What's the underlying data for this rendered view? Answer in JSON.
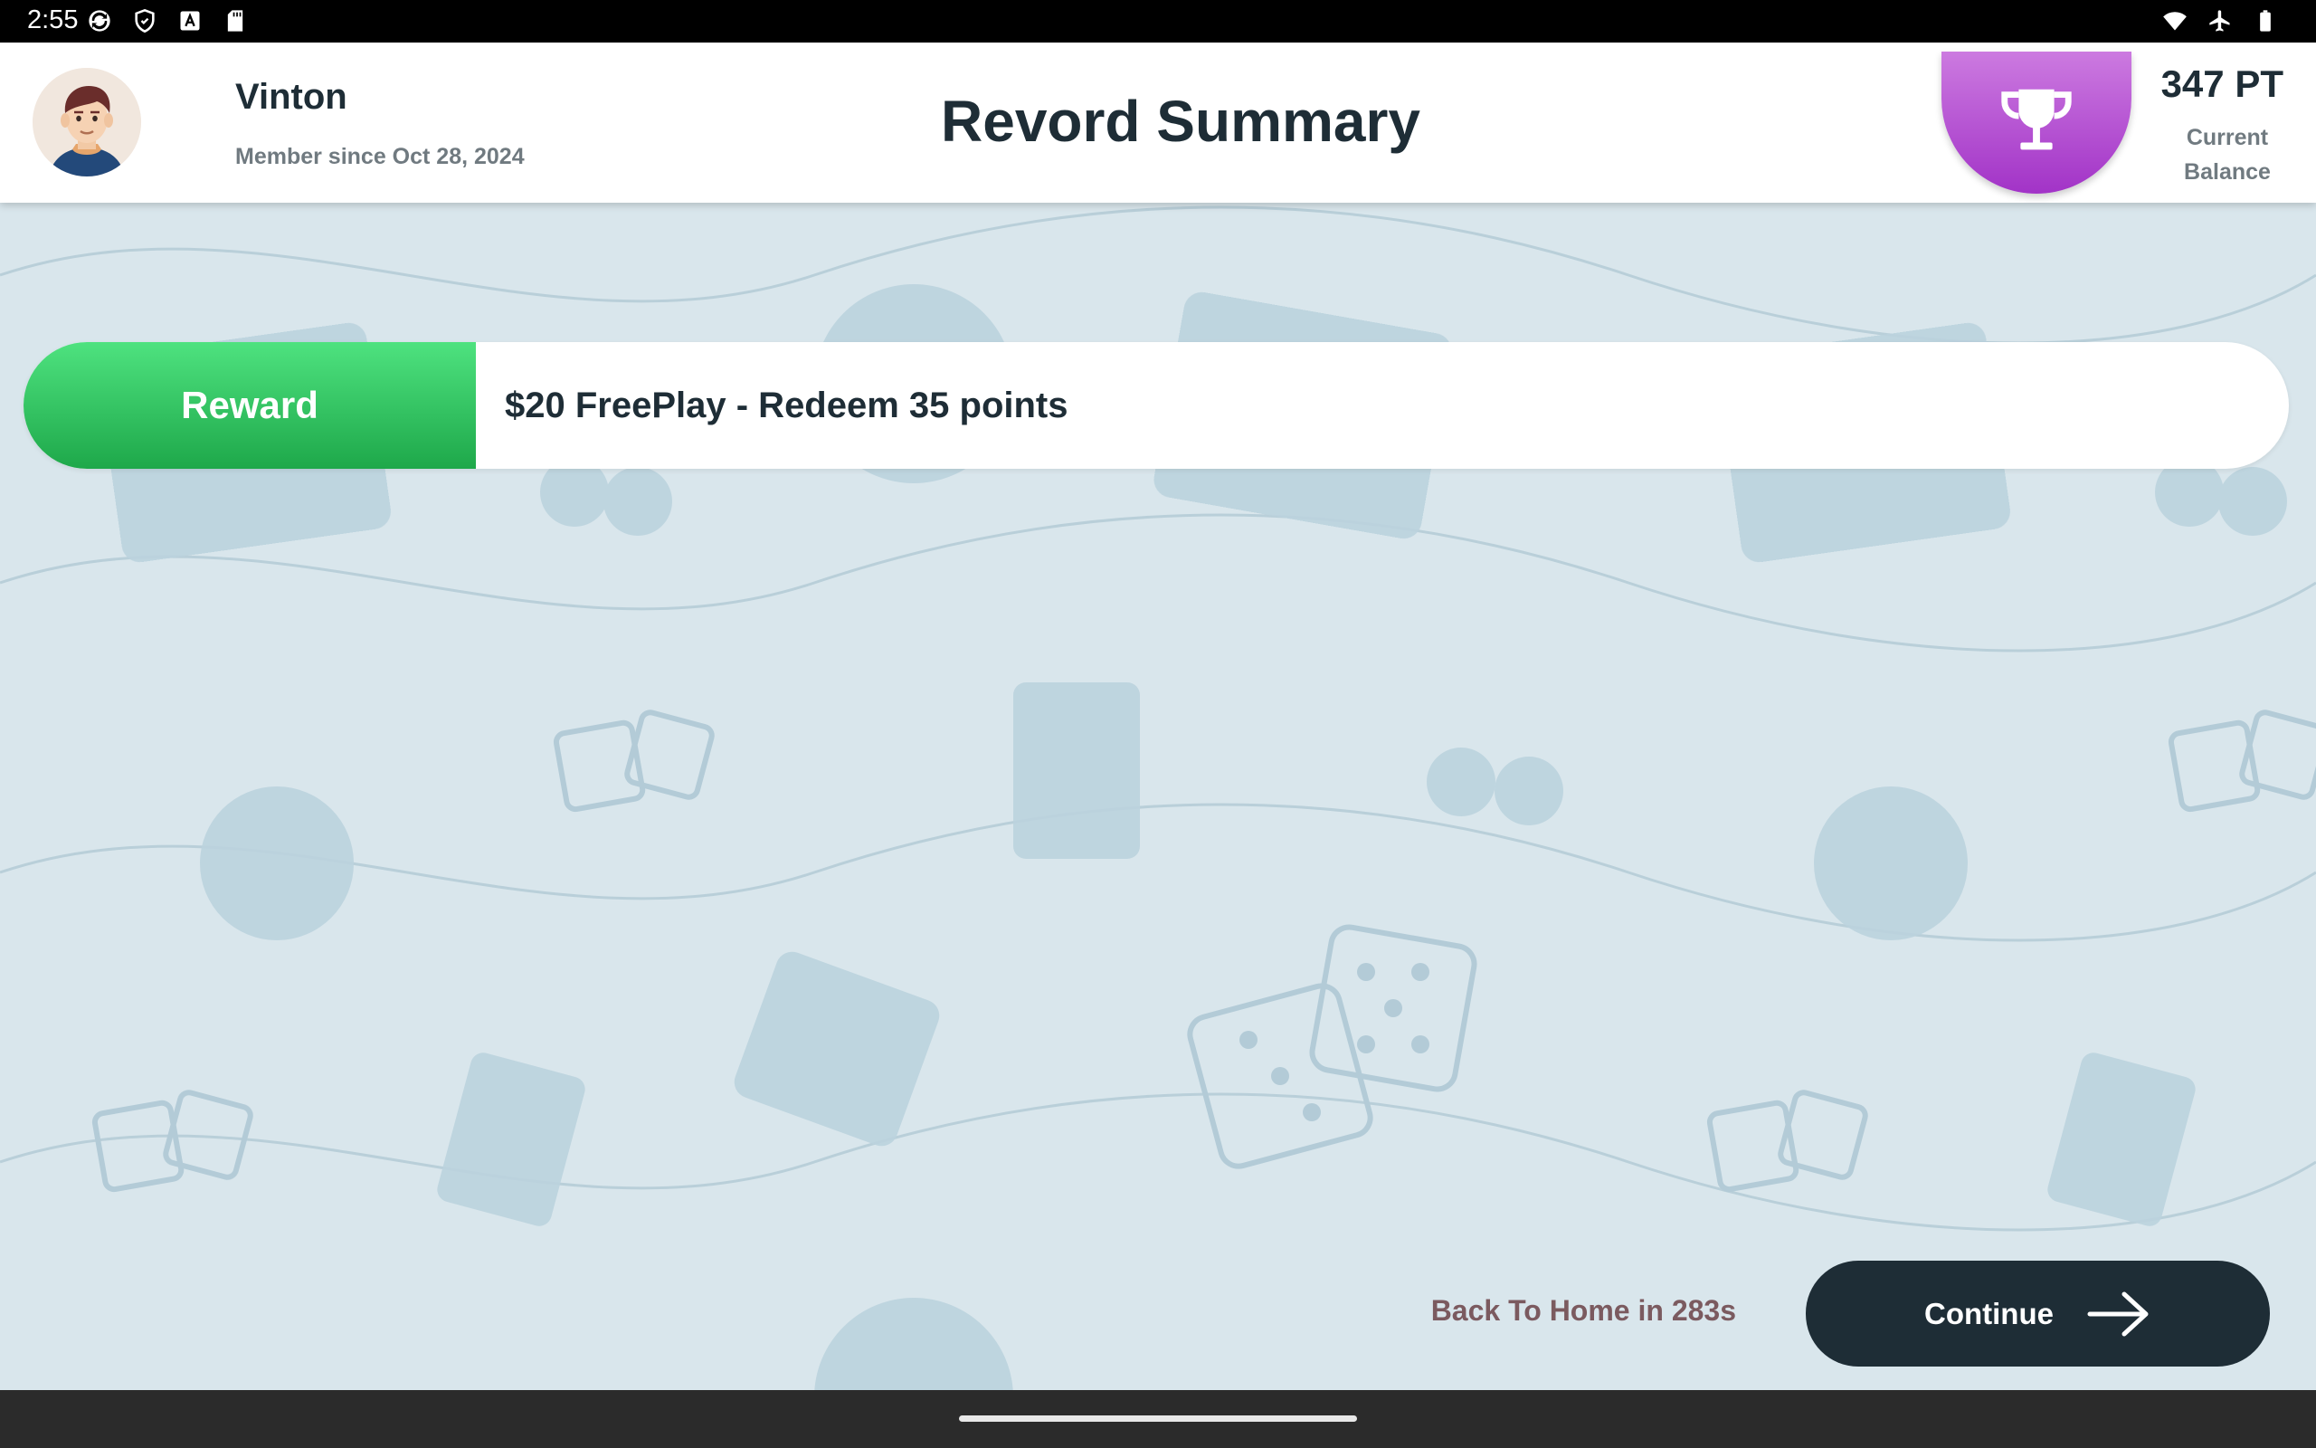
{
  "status_bar": {
    "time": "2:55",
    "left_icons": [
      "sync-icon",
      "shield-icon",
      "font-icon",
      "sd-card-icon"
    ],
    "right_icons": [
      "wifi-icon",
      "airplane-icon",
      "battery-icon"
    ]
  },
  "header": {
    "user_name": "Vinton",
    "member_since": "Member since Oct 28, 2024",
    "title": "Revord Summary",
    "points": "347 PT",
    "points_label": "Current Balance"
  },
  "reward": {
    "tag": "Reward",
    "description": "$20 FreePlay - Redeem 35 points"
  },
  "footer": {
    "back_home": "Back To Home in 283s",
    "continue_label": "Continue"
  },
  "colors": {
    "background": "#d9e6ec",
    "dark": "#1e2d36",
    "reward_green": "#2cc55e",
    "trophy_purple": "#b24fd4",
    "countdown": "#7b5a5f"
  }
}
